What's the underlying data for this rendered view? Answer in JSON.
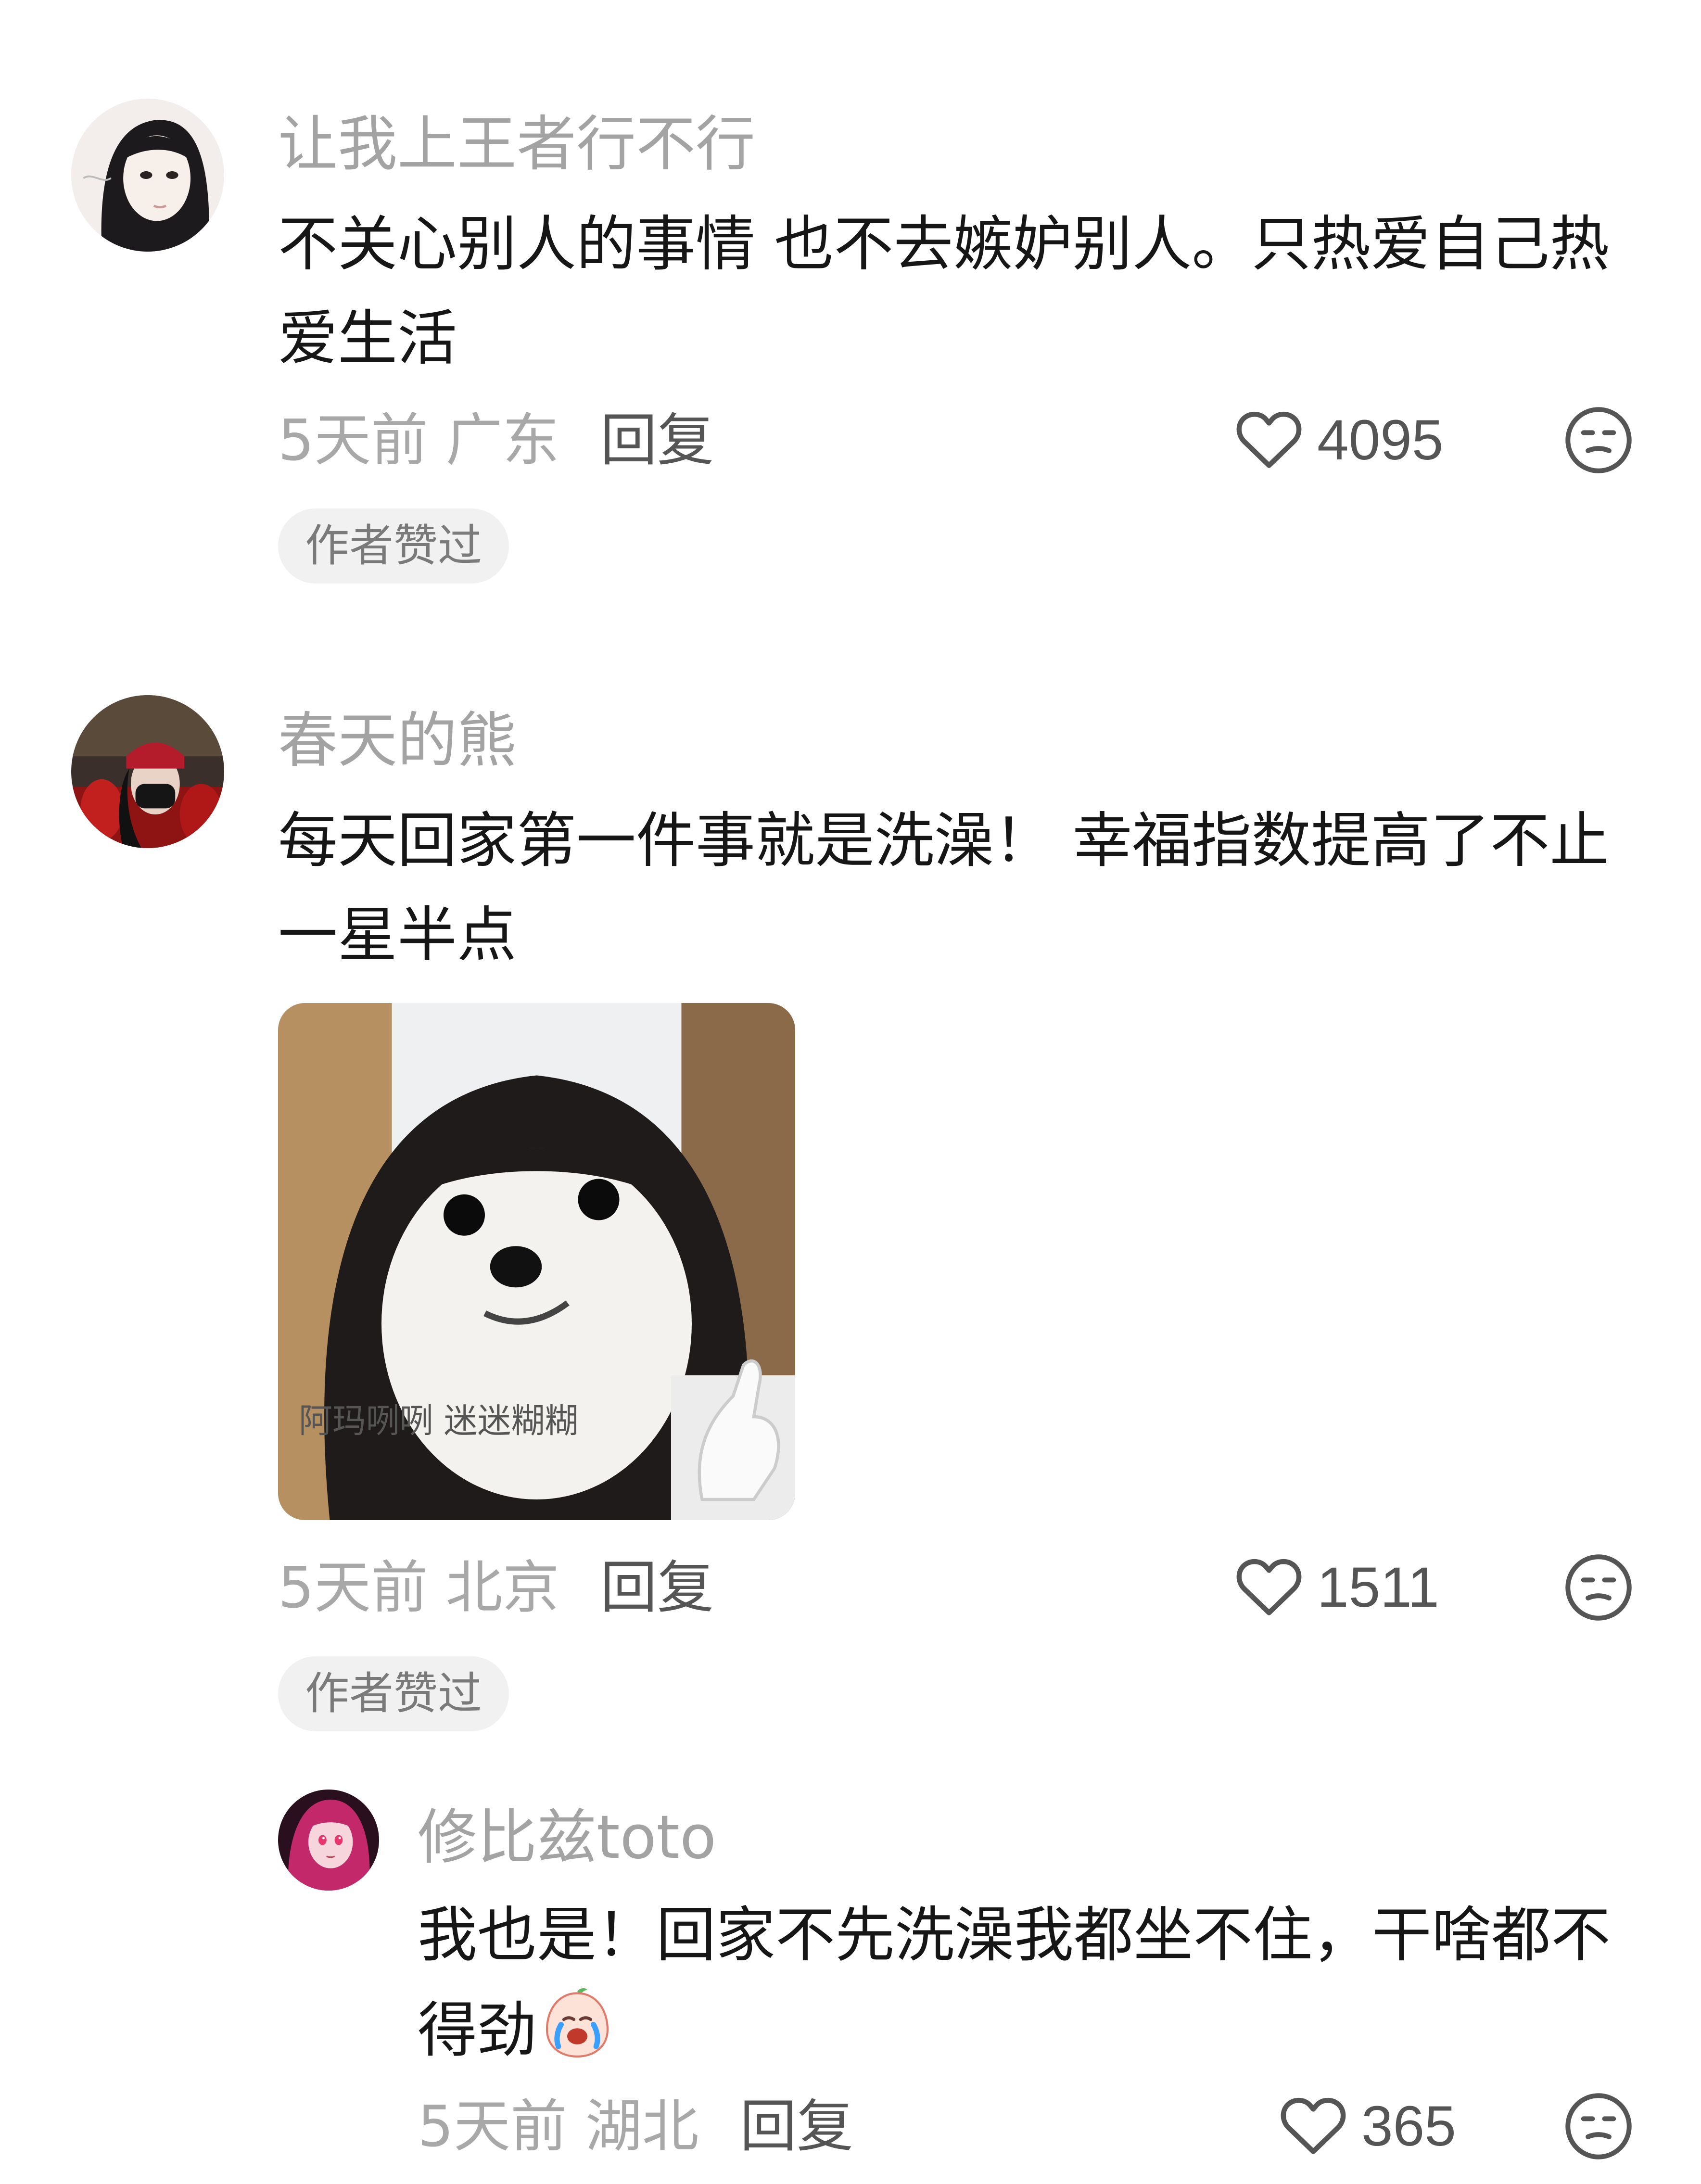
{
  "comments": [
    {
      "username": "让我上王者行不行",
      "content": "不关心别人的事情 也不去嫉妒别人。只热爱自己热爱生活",
      "time_location": "5天前 广东",
      "reply_label": "回复",
      "like_count": "4095",
      "badge": "作者赞过"
    },
    {
      "username": "春天的熊",
      "content": "每天回家第一件事就是洗澡！ 幸福指数提高了不止一星半点",
      "time_location": "5天前 北京",
      "reply_label": "回复",
      "like_count": "1511",
      "badge": "作者赞过",
      "image_caption": "阿玛咧咧 迷迷糊糊"
    },
    {
      "username": "修比兹toto",
      "content": "我也是！回家不先洗澡我都坐不住，干啥都不得劲",
      "time_location": "5天前 湖北",
      "reply_label": "回复",
      "like_count": "365"
    }
  ],
  "icons": {
    "like": "heart-outline-icon",
    "dislike": "neutral-face-icon",
    "emoji": "crying-face-emoji"
  },
  "colors": {
    "username": "#a3a3a3",
    "content": "#161616",
    "meta": "#a8a8a8",
    "action": "#555555",
    "badge_bg": "#f1f1f1"
  }
}
